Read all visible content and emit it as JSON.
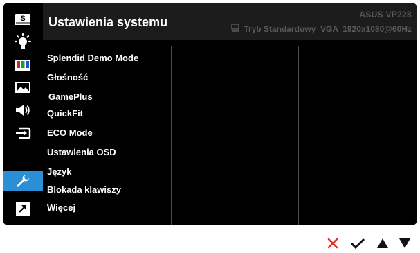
{
  "header": {
    "title": "Ustawienia systemu",
    "model": "ASUS  VP228",
    "status": "Tryb Standardowy  VGA  1920x1080@60Hz"
  },
  "sidebar": {
    "items": [
      {
        "name": "splendid",
        "icon": "splendid-s-icon",
        "active": false
      },
      {
        "name": "blue-light-filter",
        "icon": "brightness-sun-icon",
        "active": false
      },
      {
        "name": "color",
        "icon": "color-bars-icon",
        "active": false
      },
      {
        "name": "image",
        "icon": "image-landscape-icon",
        "active": false
      },
      {
        "name": "sound",
        "icon": "speaker-icon",
        "active": false
      },
      {
        "name": "input-select",
        "icon": "input-select-icon",
        "active": false
      },
      {
        "name": "system-setup",
        "icon": "wrench-icon",
        "active": true
      },
      {
        "name": "shortcut",
        "icon": "shortcut-arrow-icon",
        "active": false
      }
    ]
  },
  "menu": {
    "items": [
      "Splendid Demo Mode",
      "Głośność",
      "GamePlus",
      "QuickFit",
      "ECO Mode",
      "Ustawienia OSD",
      "Język",
      "Blokada klawiszy",
      "Więcej"
    ]
  },
  "controls": {
    "buttons": [
      {
        "name": "close",
        "icon": "close-x-icon"
      },
      {
        "name": "confirm",
        "icon": "checkmark-icon"
      },
      {
        "name": "up",
        "icon": "up-triangle-icon"
      },
      {
        "name": "down",
        "icon": "down-triangle-icon"
      }
    ]
  },
  "colors": {
    "accent": "#2a8fd6",
    "close": "#e0312a",
    "panel": "#000000",
    "header_bg": "#1c1c1c",
    "muted_text": "#5a5a5a"
  }
}
